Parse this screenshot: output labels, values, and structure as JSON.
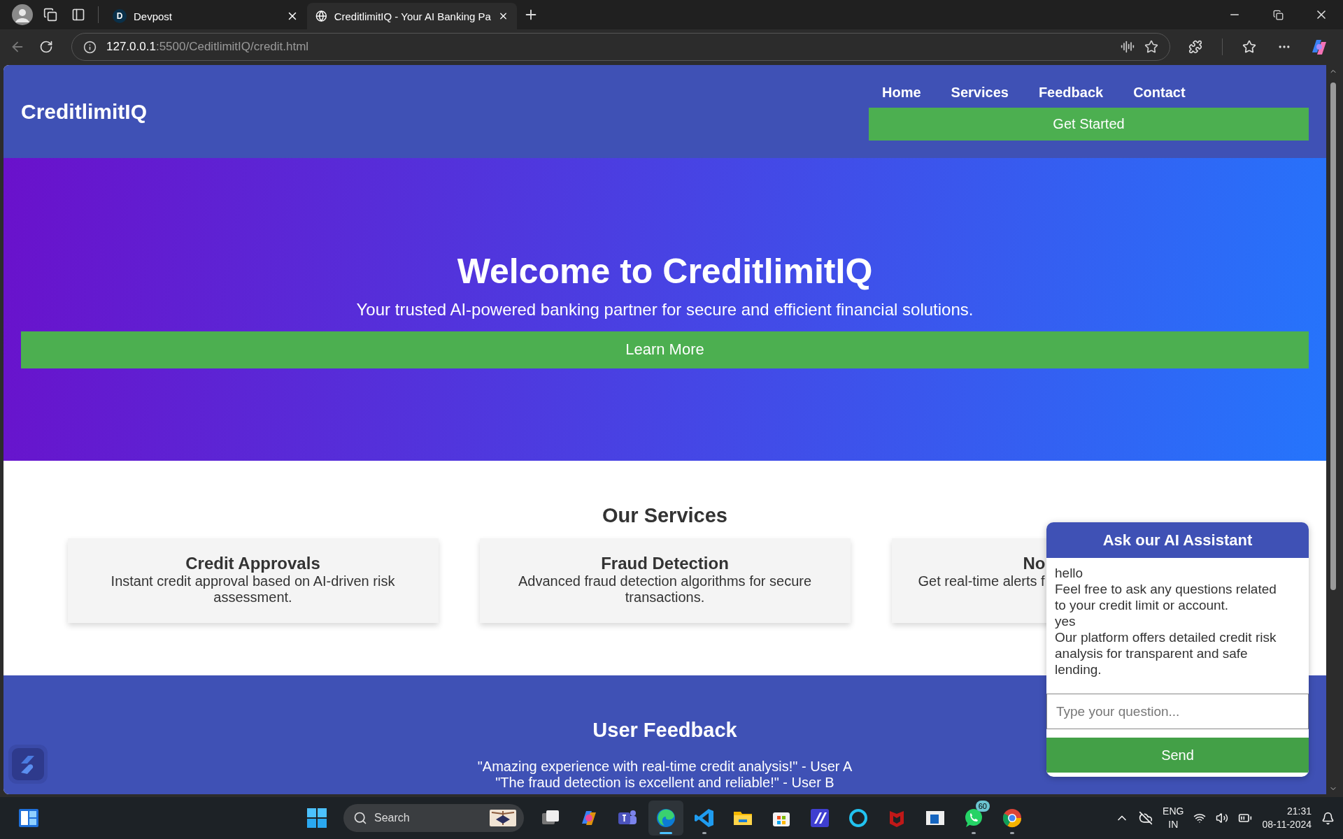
{
  "browser": {
    "tabs": [
      {
        "title": "Devpost",
        "favicon_text": "D",
        "selected": false
      },
      {
        "title": "CreditlimitIQ - Your AI Banking Pa",
        "selected": true
      }
    ],
    "url_host": "127.0.0.1",
    "url_path": ":5500/CeditlimitIQ/credit.html"
  },
  "site": {
    "logo": "CreditlimitIQ",
    "nav": [
      "Home",
      "Services",
      "Feedback",
      "Contact"
    ],
    "cta": "Get Started",
    "hero": {
      "title": "Welcome to CreditlimitIQ",
      "subtitle": "Your trusted AI-powered banking partner for secure and efficient financial solutions.",
      "button": "Learn More"
    },
    "services": {
      "title": "Our Services",
      "cards": [
        {
          "title": "Credit Approvals",
          "description": "Instant credit approval based on AI-driven risk assessment.",
          "covered": false
        },
        {
          "title": "Fraud Detection",
          "description": "Advanced fraud detection algorithms for secure transactions.",
          "covered": false
        },
        {
          "title": "No",
          "description": "Get real-time alerts f",
          "covered": true
        }
      ]
    },
    "feedback": {
      "title": "User Feedback",
      "quotes": [
        "\"Amazing experience with real-time credit analysis!\" - User A",
        "\"The fraud detection is excellent and reliable!\" - User B"
      ]
    },
    "chat": {
      "title": "Ask our AI Assistant",
      "messages": [
        "hello",
        "Feel free to ask any questions related to your credit limit or account.",
        "yes",
        "Our platform offers detailed credit risk analysis for transparent and safe lending."
      ],
      "placeholder": "Type your question...",
      "button": "Send"
    }
  },
  "taskbar": {
    "search_placeholder": "Search",
    "apps": [
      {
        "kind": "taskview",
        "running": false,
        "active": false
      },
      {
        "kind": "copilot",
        "running": false,
        "active": false
      },
      {
        "kind": "teams",
        "running": false,
        "active": false
      },
      {
        "kind": "edge",
        "running": true,
        "active": true
      },
      {
        "kind": "vscode",
        "running": true,
        "active": false
      },
      {
        "kind": "explorer",
        "running": false,
        "active": false
      },
      {
        "kind": "store",
        "running": false,
        "active": false
      },
      {
        "kind": "studio",
        "running": false,
        "active": false
      },
      {
        "kind": "alexa",
        "running": false,
        "active": false
      },
      {
        "kind": "mcafee",
        "running": false,
        "active": false
      },
      {
        "kind": "window",
        "running": false,
        "active": false
      },
      {
        "kind": "whatsapp",
        "running": true,
        "active": false,
        "badge": "60"
      },
      {
        "kind": "chrome",
        "running": true,
        "active": false
      }
    ],
    "language": [
      "ENG",
      "IN"
    ],
    "time": "21:31",
    "date": "08-11-2024"
  }
}
